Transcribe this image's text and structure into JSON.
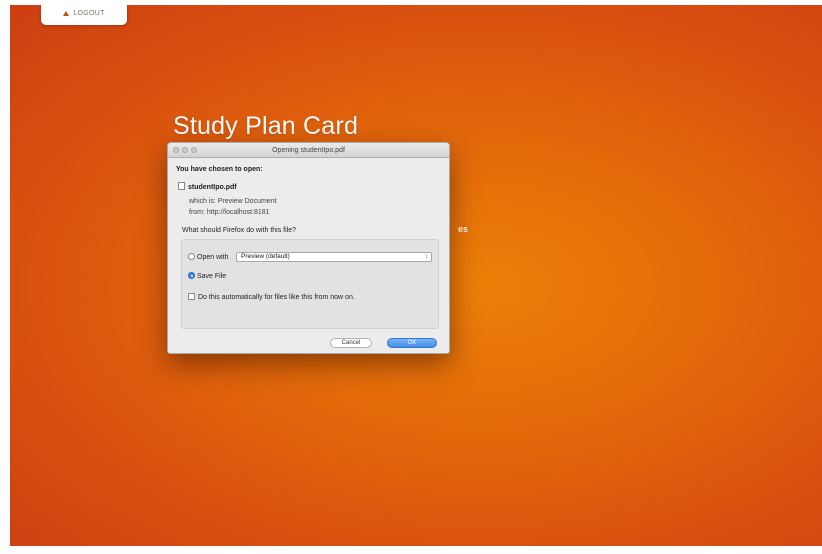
{
  "page": {
    "title": "Study Plan Card",
    "logout_label": "LOGOUT",
    "partially_hidden_text": "es"
  },
  "dialog": {
    "title": "Opening studentIpo.pdf",
    "intro": "You have chosen to open:",
    "file_name": "studentIpo.pdf",
    "which_is": "which is:  Preview Document",
    "from": "from:  http://localhost:8181",
    "question": "What should Firefox do with this file?",
    "open_with_label": "Open with",
    "open_with_value": "Preview (default)",
    "save_file_label": "Save File",
    "auto_label": "Do this automatically for files like this from now on.",
    "selected_action": "save_file",
    "cancel_label": "Cancel",
    "ok_label": "OK"
  },
  "colors": {
    "background_center": "#ed7f08",
    "background_edge": "#cd3e12",
    "accent_button": "#3f8ae8"
  }
}
